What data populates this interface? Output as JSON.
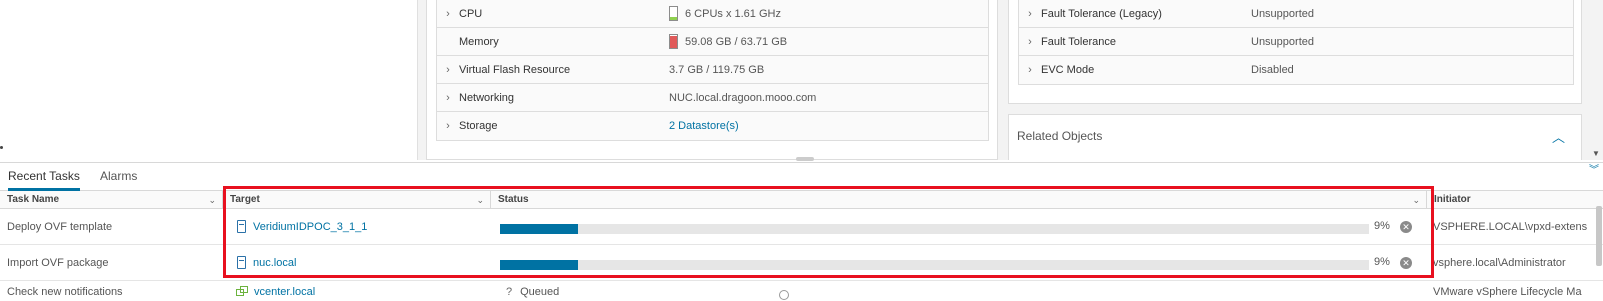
{
  "hardware": [
    {
      "label": "CPU",
      "value": "6 CPUs x 1.61 GHz",
      "expandable": true,
      "meter": "cpu"
    },
    {
      "label": "Memory",
      "value": "59.08 GB / 63.71 GB",
      "expandable": false,
      "meter": "memory"
    },
    {
      "label": "Virtual Flash Resource",
      "value": "3.7 GB / 119.75 GB",
      "expandable": true
    },
    {
      "label": "Networking",
      "value": "NUC.local.dragoon.mooo.com",
      "expandable": true
    },
    {
      "label": "Storage",
      "value": "2 Datastore(s)",
      "expandable": true,
      "link": true
    }
  ],
  "meters": {
    "cpu": {
      "level": 0.2,
      "color": "#8fd14f"
    },
    "memory": {
      "level": 0.93,
      "color": "#e05a5a"
    }
  },
  "fault_tolerance": [
    {
      "label": "Fault Tolerance (Legacy)",
      "value": "Unsupported"
    },
    {
      "label": "Fault Tolerance",
      "value": "Unsupported"
    },
    {
      "label": "EVC Mode",
      "value": "Disabled"
    }
  ],
  "related_objects": {
    "title": "Related Objects"
  },
  "tasks_panel": {
    "tabs": [
      "Recent Tasks",
      "Alarms"
    ],
    "active_tab": "Recent Tasks",
    "columns": [
      "Task Name",
      "Target",
      "Status",
      "Initiator"
    ],
    "rows": [
      {
        "task": "Deploy OVF template",
        "target": "VeridiumIDPOC_3_1_1",
        "status_type": "progress",
        "progress": 9,
        "progress_label": "9%",
        "initiator": "VSPHERE.LOCAL\\vpxd-extens"
      },
      {
        "task": "Import OVF package",
        "target": "nuc.local",
        "status_type": "progress",
        "progress": 9,
        "progress_label": "9%",
        "initiator": "vsphere.local\\Administrator"
      },
      {
        "task": "Check new notifications",
        "target": "vcenter.local",
        "status_type": "text",
        "status_text": "Queued",
        "initiator": "VMware vSphere Lifecycle Ma"
      }
    ]
  },
  "colors": {
    "accent": "#0072a3",
    "highlight": "#e8101f",
    "progress": "#0072a3"
  }
}
